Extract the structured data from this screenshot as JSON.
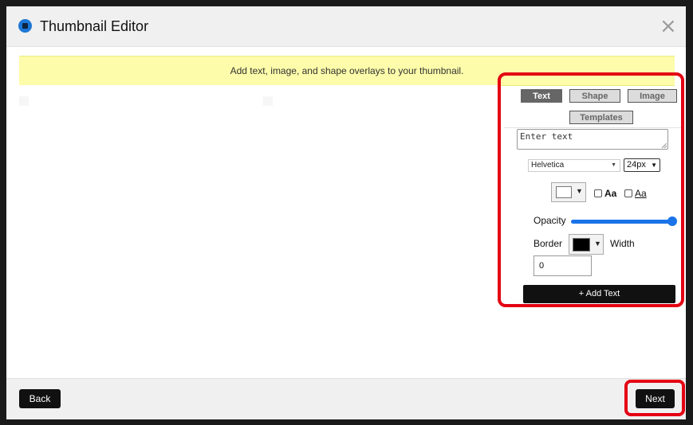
{
  "dialog": {
    "title": "Thumbnail Editor",
    "close_icon": "close-icon",
    "brand_color": "#1d77d6"
  },
  "banner": {
    "text": "Add text, image, and shape overlays to your thumbnail.",
    "background": "#fcfcaa"
  },
  "tabs": [
    {
      "label": "Text",
      "active": true
    },
    {
      "label": "Shape",
      "active": false
    },
    {
      "label": "Image",
      "active": false
    },
    {
      "label": "Templates",
      "active": false
    }
  ],
  "text_panel": {
    "text_placeholder": "Enter text",
    "font_family": "Helvetica",
    "font_size": "24px",
    "text_color": "#ffffff",
    "bold_label": "Aa",
    "underline_label": "Aa",
    "opacity_label": "Opacity",
    "opacity_value": 1.0,
    "slider_color": "#1a73e8",
    "border_label": "Border",
    "border_color": "#000000",
    "width_label": "Width",
    "width_value": "0",
    "add_button_label": "+ Add Text"
  },
  "footer": {
    "back_label": "Back",
    "next_label": "Next"
  },
  "highlight_color": "#e40012"
}
